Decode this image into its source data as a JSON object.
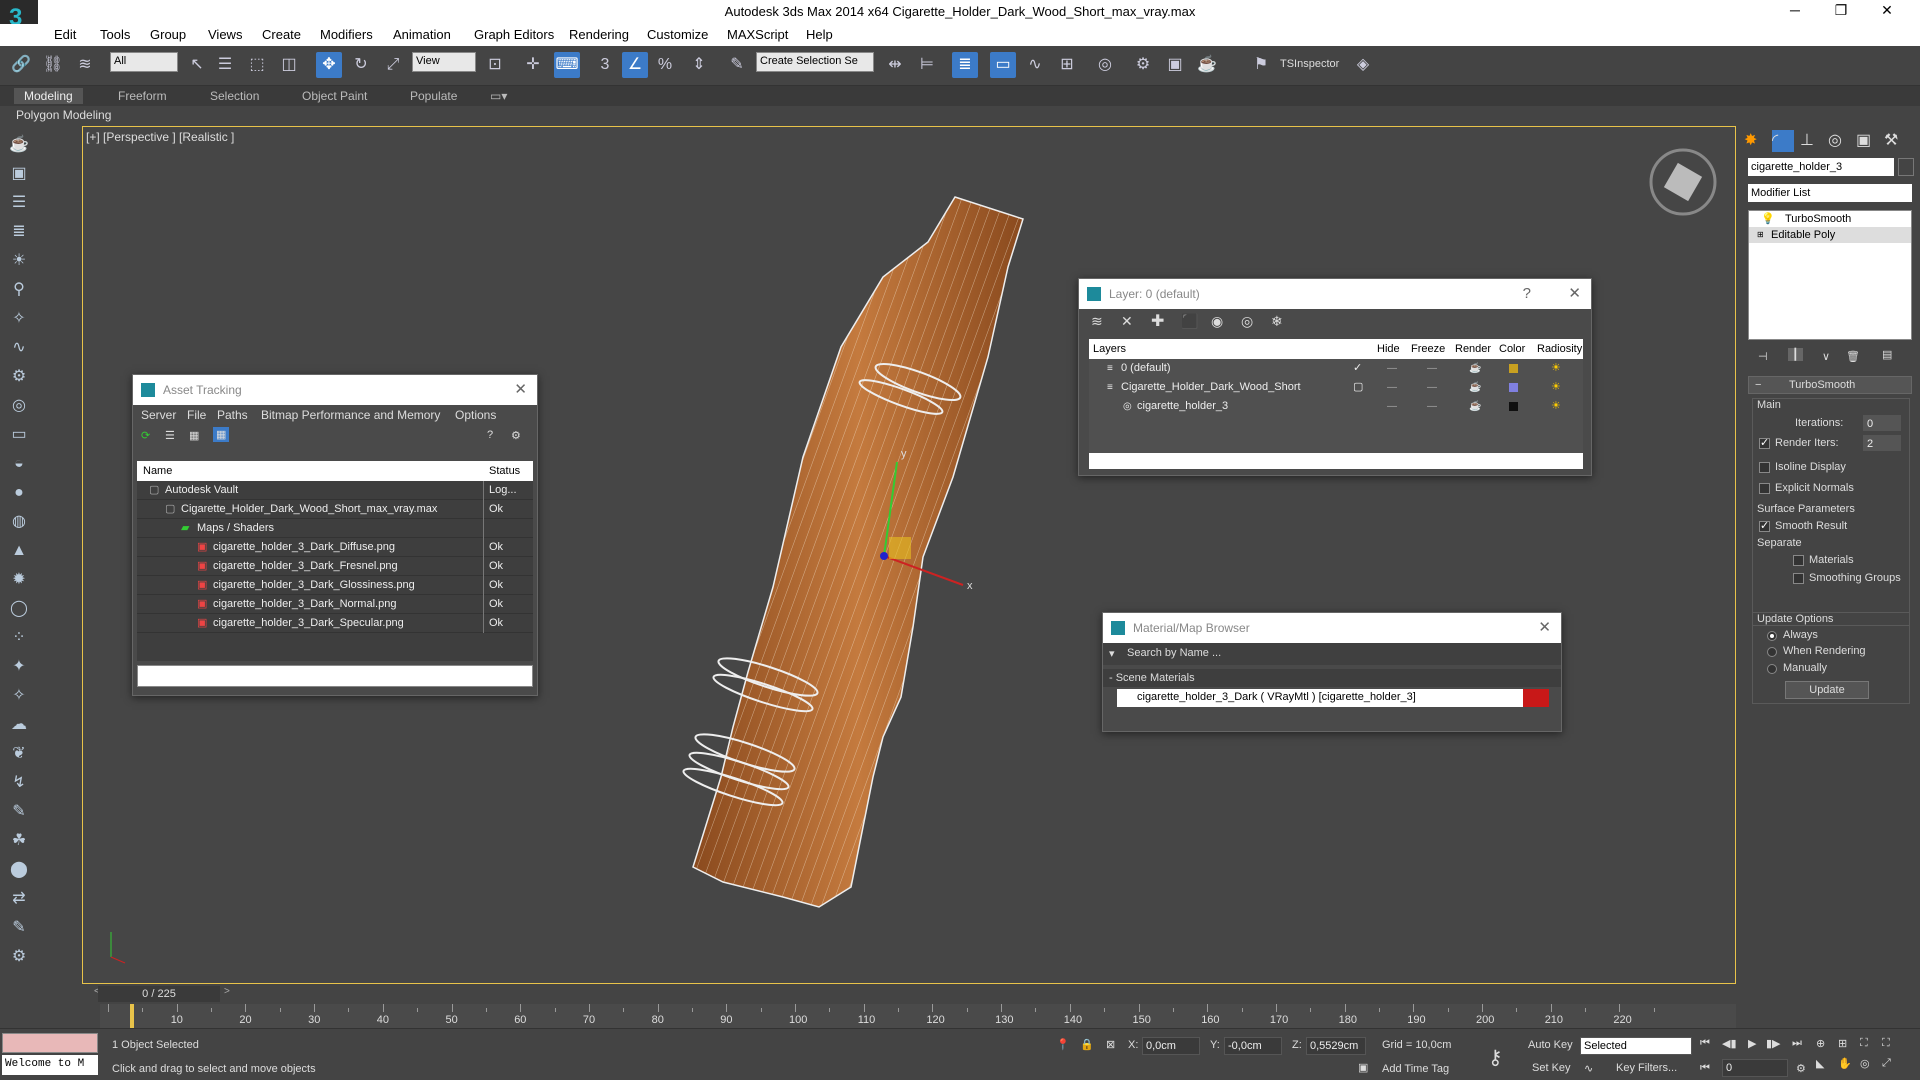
{
  "titlebar": {
    "title": "Autodesk 3ds Max  2014 x64     Cigarette_Holder_Dark_Wood_Short_max_vray.max",
    "min": "─",
    "max": "❐",
    "close": "✕"
  },
  "menu": [
    "Edit",
    "Tools",
    "Group",
    "Views",
    "Create",
    "Modifiers",
    "Animation",
    "Graph Editors",
    "Rendering",
    "Customize",
    "MAXScript",
    "Help"
  ],
  "toolbar": {
    "filter": "All",
    "refcoord": "View",
    "selset": "Create Selection Se",
    "tsinspector": "TSInspector"
  },
  "ribbon": {
    "tabs": [
      "Modeling",
      "Freeform",
      "Selection",
      "Object Paint",
      "Populate"
    ],
    "sub": "Polygon Modeling"
  },
  "viewport": {
    "label": "[+] [Perspective ] [Realistic ]",
    "x_axis": "x",
    "y_axis": "y"
  },
  "asset": {
    "title": "Asset Tracking",
    "menu": [
      "Server",
      "File",
      "Paths",
      "Bitmap Performance and Memory",
      "Options"
    ],
    "cols": {
      "name": "Name",
      "status": "Status"
    },
    "rows": [
      {
        "name": "Autodesk Vault",
        "status": "Log...",
        "indent": 0
      },
      {
        "name": "Cigarette_Holder_Dark_Wood_Short_max_vray.max",
        "status": "Ok",
        "indent": 1
      },
      {
        "name": "Maps / Shaders",
        "status": "",
        "indent": 2
      },
      {
        "name": "cigarette_holder_3_Dark_Diffuse.png",
        "status": "Ok",
        "indent": 3
      },
      {
        "name": "cigarette_holder_3_Dark_Fresnel.png",
        "status": "Ok",
        "indent": 3
      },
      {
        "name": "cigarette_holder_3_Dark_Glossiness.png",
        "status": "Ok",
        "indent": 3
      },
      {
        "name": "cigarette_holder_3_Dark_Normal.png",
        "status": "Ok",
        "indent": 3
      },
      {
        "name": "cigarette_holder_3_Dark_Specular.png",
        "status": "Ok",
        "indent": 3
      }
    ]
  },
  "layer": {
    "title": "Layer: 0 (default)",
    "help": "?",
    "cols": [
      "Layers",
      "Hide",
      "Freeze",
      "Render",
      "Color",
      "Radiosity"
    ],
    "rows": [
      {
        "name": "0 (default)",
        "color": "#c8a020"
      },
      {
        "name": "Cigarette_Holder_Dark_Wood_Short",
        "color": "#8080e0"
      },
      {
        "name": "cigarette_holder_3",
        "color": "#101010"
      }
    ]
  },
  "matbrowser": {
    "title": "Material/Map Browser",
    "search": "Search by Name ...",
    "group": "- Scene Materials",
    "item": "cigarette_holder_3_Dark  ( VRayMtl ) [cigarette_holder_3]"
  },
  "cmd": {
    "objname": "cigarette_holder_3",
    "modlist": "Modifier List",
    "stack": [
      "TurboSmooth",
      "Editable Poly"
    ],
    "rollout": "TurboSmooth",
    "main": "Main",
    "iterations_label": "Iterations:",
    "iterations": "0",
    "render_iters_label": "Render Iters:",
    "render_iters": "2",
    "isoline": "Isoline Display",
    "explicit": "Explicit Normals",
    "surface": "Surface Parameters",
    "smooth": "Smooth Result",
    "separate": "Separate",
    "materials": "Materials",
    "smoothing": "Smoothing Groups",
    "update_options": "Update Options",
    "always": "Always",
    "when_rendering": "When Rendering",
    "manually": "Manually",
    "update": "Update"
  },
  "timeline": {
    "frame": "0 / 225",
    "ticks": [
      "10",
      "20",
      "30",
      "40",
      "50",
      "60",
      "70",
      "80",
      "90",
      "100",
      "110",
      "120",
      "130",
      "140",
      "150",
      "160",
      "170",
      "180",
      "190",
      "200",
      "210",
      "220"
    ]
  },
  "status": {
    "welcome": "Welcome to M",
    "selected": "1 Object Selected",
    "hint": "Click and drag to select and move objects",
    "x_label": "X:",
    "x": "0,0cm",
    "y_label": "Y:",
    "y": "-0,0cm",
    "z_label": "Z:",
    "z": "0,5529cm",
    "grid": "Grid = 10,0cm",
    "autokey": "Auto Key",
    "setkey": "Set Key",
    "keymode": "Selected",
    "keyfilters": "Key Filters...",
    "addtimetag": "Add Time Tag",
    "frame": "0"
  }
}
